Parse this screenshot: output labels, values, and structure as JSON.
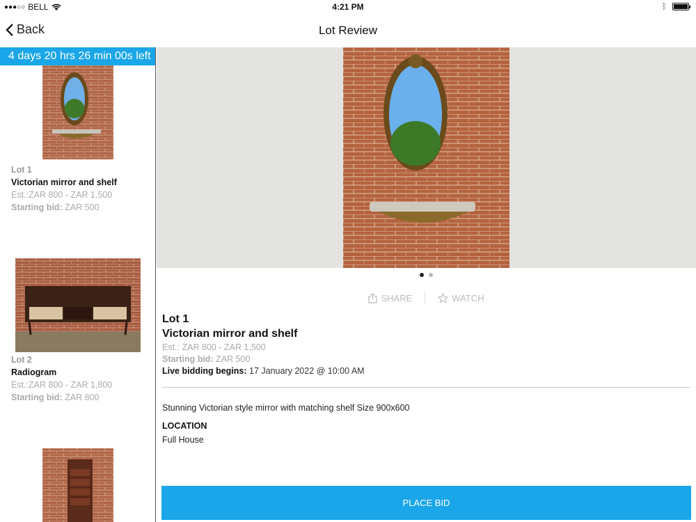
{
  "status_bar": {
    "carrier": "BELL",
    "time": "4:21 PM"
  },
  "nav": {
    "back_label": "Back",
    "title": "Lot Review"
  },
  "countdown": "4 days 20 hrs 26 min 00s left",
  "lots": [
    {
      "lot": "Lot 1",
      "title": "Victorian mirror and shelf",
      "estimate": "Est.:ZAR 800 - ZAR 1,500",
      "starting_label": "Starting bid:",
      "starting_value": "ZAR 500"
    },
    {
      "lot": "Lot 2",
      "title": "Radiogram",
      "estimate": "Est.:ZAR 800 - ZAR 1,800",
      "starting_label": "Starting bid:",
      "starting_value": "ZAR 800"
    }
  ],
  "detail": {
    "lot": "Lot 1",
    "title": "Victorian mirror and shelf",
    "estimate": "Est.: ZAR 800 - ZAR 1,500",
    "starting_label": "Starting bid:",
    "starting_value": "ZAR 500",
    "live_label": "Live bidding begins:",
    "live_value": "17 January 2022 @ 10:00 AM",
    "description": "Stunning Victorian style mirror with matching shelf Size 900x600",
    "location_heading": "LOCATION",
    "location_value": "Full House",
    "share_label": "SHARE",
    "watch_label": "WATCH",
    "image_count": 2,
    "active_image": 1
  },
  "place_bid_label": "PLACE BID",
  "colors": {
    "accent": "#1aa6e8",
    "brick": "#a0573a",
    "hero_bg": "#e3e3e0"
  }
}
